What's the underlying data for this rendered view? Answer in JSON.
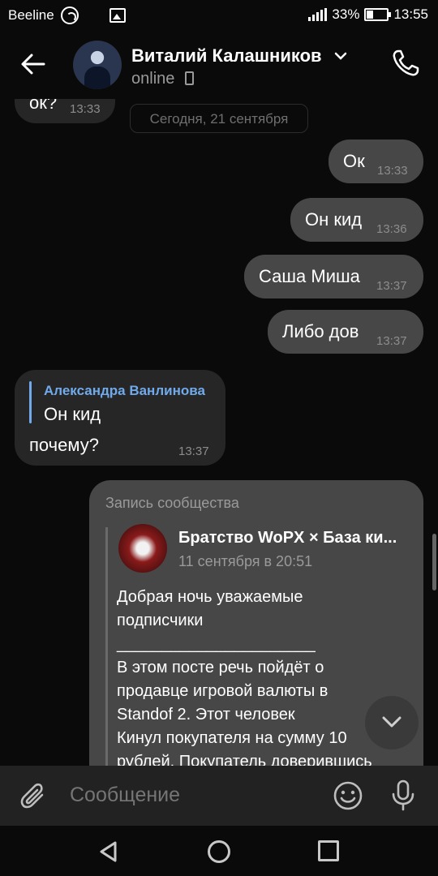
{
  "status_bar": {
    "carrier": "Beeline",
    "battery": "33%",
    "time": "13:55"
  },
  "header": {
    "name": "Виталий Калашников",
    "status": "online"
  },
  "chat": {
    "date_divider": "Сегодня, 21 сентября",
    "messages": [
      {
        "dir": "in",
        "text": "ок?",
        "time": "13:33"
      },
      {
        "dir": "out",
        "text": "Ок",
        "time": "13:33"
      },
      {
        "dir": "out",
        "text": "Он кид",
        "time": "13:36"
      },
      {
        "dir": "out",
        "text": "Саша Миша",
        "time": "13:37"
      },
      {
        "dir": "out",
        "text": "Либо дов",
        "time": "13:37"
      },
      {
        "dir": "in",
        "reply_author": "Александра Ванлинова",
        "reply_text": "Он кид",
        "text": "почему?",
        "time": "13:37"
      }
    ],
    "post": {
      "label": "Запись сообщества",
      "title": "Братство WoPX × База ки...",
      "date": "11 сентября в 20:51",
      "lines": [
        "Добрая ночь уважаемые",
        "подписчики",
        "______________________",
        "В этом посте речь пойдёт о",
        "продавце игровой валюты в",
        "Standof 2. Этот человек",
        "Кинул покупателя на сумму 10",
        "рублей. Покупатель доверившись"
      ]
    }
  },
  "composer": {
    "placeholder": "Сообщение"
  },
  "colors": {
    "background": "#0a0a0a",
    "bubble_out": "#474747",
    "bubble_in": "#262626",
    "accent": "#71aaeb"
  }
}
